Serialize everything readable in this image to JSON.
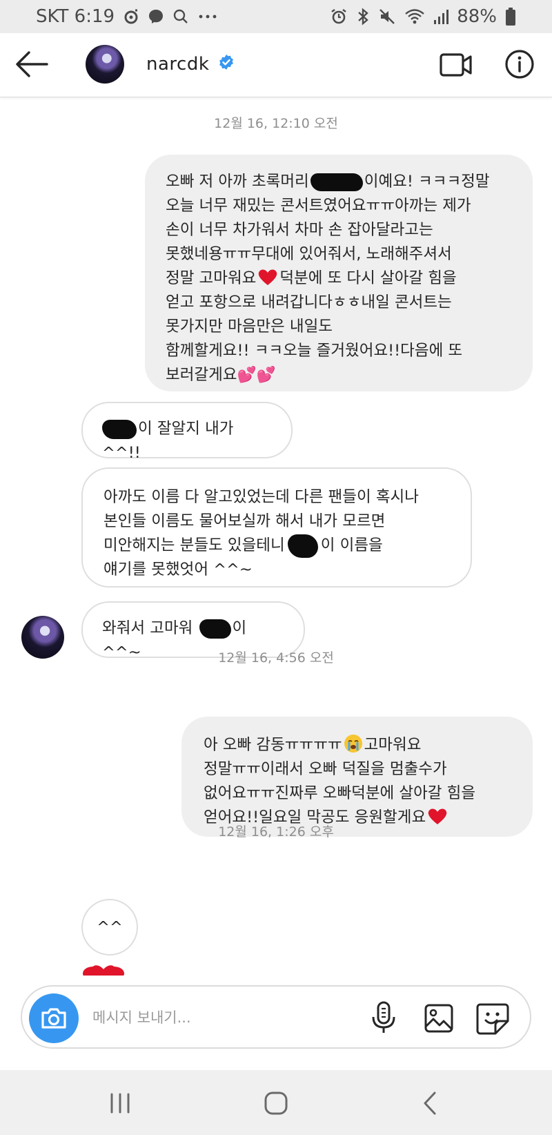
{
  "status_bar": {
    "carrier_time": "SKT 6:19",
    "battery": "88%",
    "left_icons": [
      "threads-icon",
      "messenger-icon",
      "search-icon",
      "more-icon"
    ],
    "right_icons": [
      "alarm-icon",
      "bluetooth-icon",
      "mute-icon",
      "wifi-icon",
      "signal-icon",
      "battery-icon"
    ]
  },
  "header": {
    "username": "narcdk",
    "verified": true
  },
  "messages": [
    {
      "type": "timestamp",
      "text": "12월 16, 12:10 오전"
    },
    {
      "type": "outgoing",
      "lines": [
        "오빠 저 아까 초록머리",
        "이예요! ㅋㅋㅋ정말",
        "오늘 너무 재밌는 콘서트였어요ㅠㅠ아까는 제가",
        "손이 너무 차가워서 차마 손 잡아달라고는",
        "못했네용ㅠㅠ무대에 있어줘서, 노래해주셔서",
        "정말 고마워요",
        "덕분에 또 다시 살아갈 힘을",
        "얻고 포항으로 내려갑니다ㅎㅎ내일 콘서트는",
        "못가지만 마음만은 내일도",
        "함께할게요!! ㅋㅋ오늘 즐거웠어요!!다음에 또",
        "보러갈게요",
        "💕💕"
      ]
    },
    {
      "type": "incoming",
      "text": "이 잘알지 내가 ^^!!"
    },
    {
      "type": "incoming",
      "lines": [
        "아까도 이름 다 알고있었는데 다른 팬들이 혹시나",
        "본인들 이름도 물어보실까 해서 내가 모르면",
        "미안해지는 분들도 있을테니",
        "이 이름을",
        "얘기를 못했엇어 ^^~"
      ]
    },
    {
      "type": "incoming",
      "text_before": "와줘서 고마워",
      "text_after": "이 ^^~"
    },
    {
      "type": "timestamp",
      "text": "12월 16, 4:56 오전"
    },
    {
      "type": "outgoing",
      "lines": [
        "아 오빠 감동ㅠㅠㅠㅠ",
        "고마워요",
        "정말ㅠㅠ이래서 오빠 덕질을 멈출수가",
        "없어요ㅠㅠ진짜루 오빠덕분에 살아갈 힘을",
        "얻어요!!일요일 막공도 응원할게요"
      ]
    },
    {
      "type": "timestamp",
      "text": "12월 16, 1:26 오후"
    },
    {
      "type": "incoming",
      "text": "^^"
    }
  ],
  "composer": {
    "placeholder": "메시지 보내기..."
  },
  "colors": {
    "accent": "#3797f0",
    "verified": "#3897f0",
    "heart": "#e0142a",
    "outgoing_bubble": "#efefef"
  }
}
